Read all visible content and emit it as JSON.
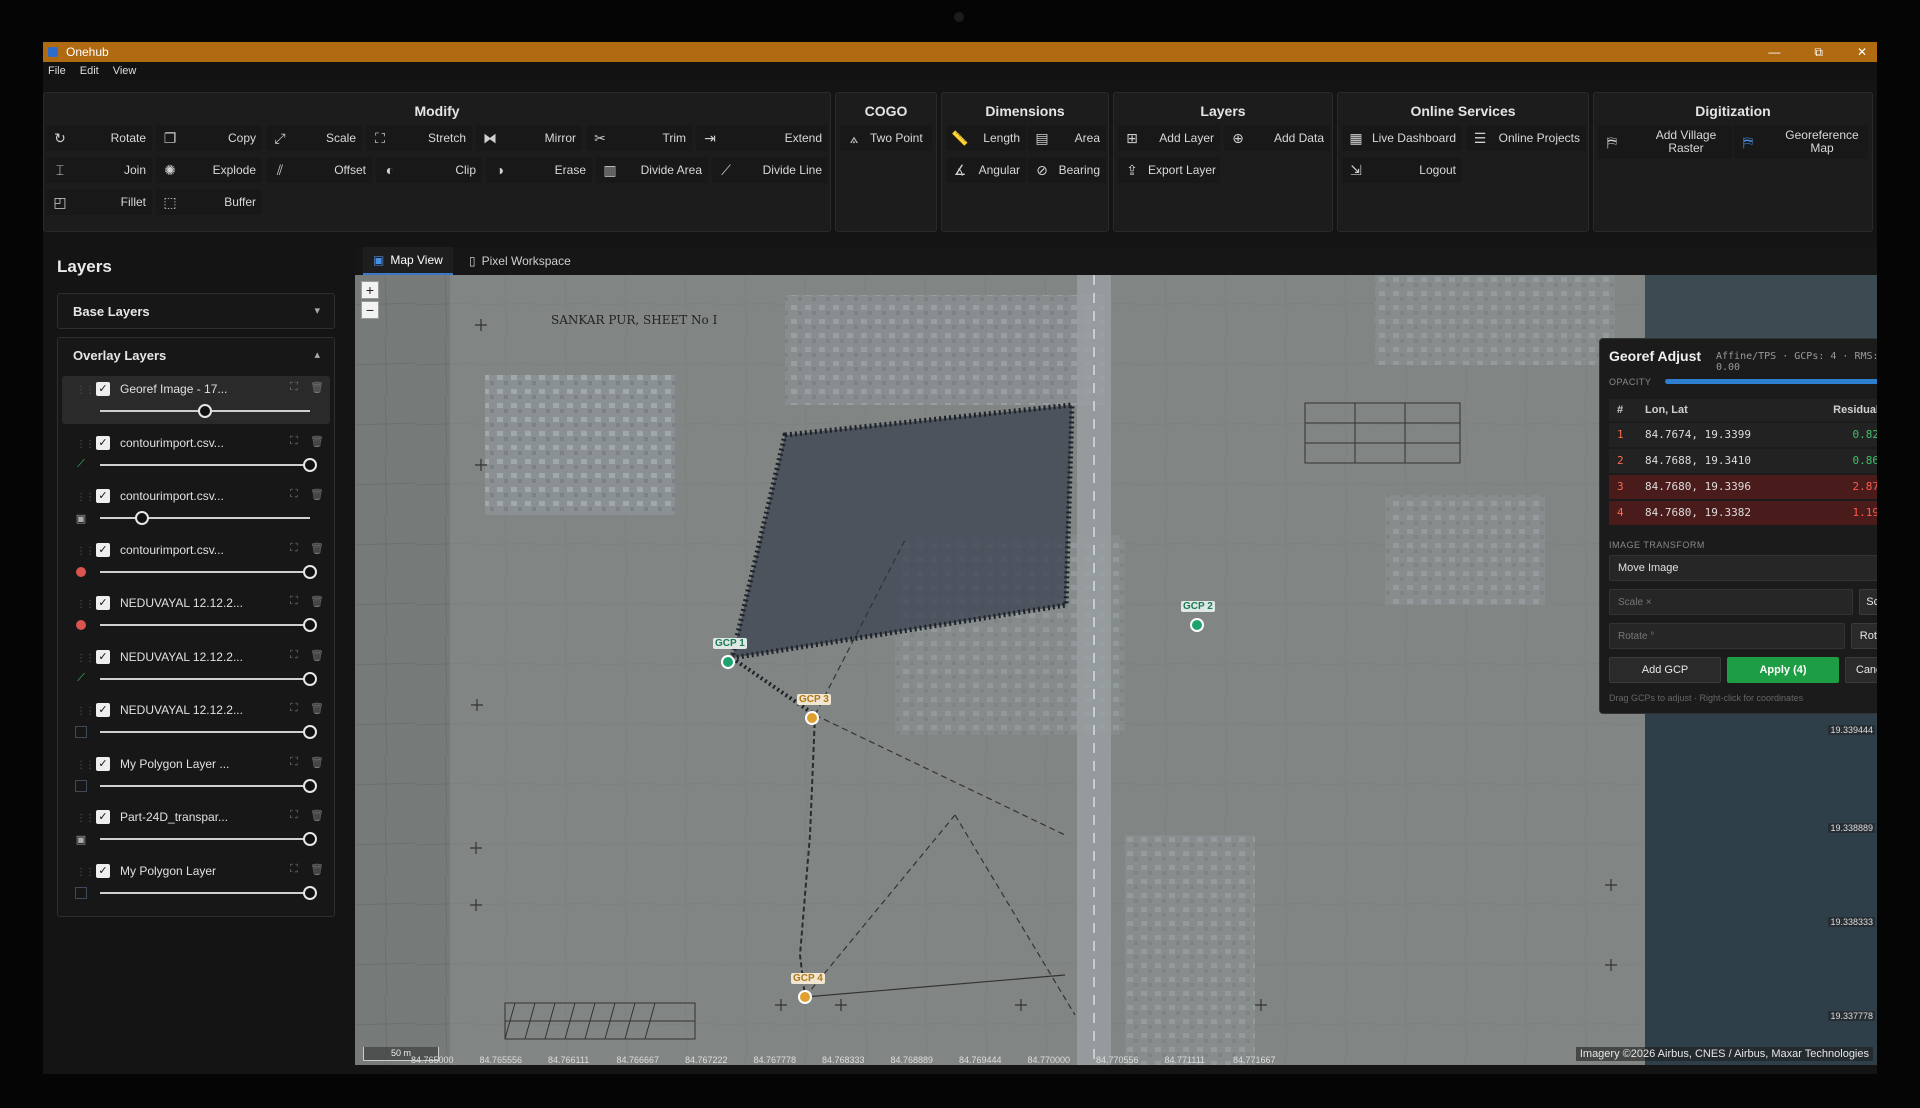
{
  "window": {
    "title": "Onehub",
    "controls": [
      "—",
      "⧉",
      "✕"
    ]
  },
  "menu": [
    "File",
    "Edit",
    "View"
  ],
  "ribbon": {
    "modify": {
      "title": "Modify",
      "tools": [
        "Rotate",
        "Copy",
        "Scale",
        "Stretch",
        "Mirror",
        "Trim",
        "Extend",
        "Join",
        "Explode",
        "Offset",
        "Clip",
        "Erase",
        "Divide Area",
        "Divide Line",
        "Fillet",
        "Buffer"
      ]
    },
    "cogo": {
      "title": "COGO",
      "tools": [
        "Two Point"
      ]
    },
    "dimensions": {
      "title": "Dimensions",
      "tools": [
        "Length",
        "Area",
        "Angular",
        "Bearing"
      ]
    },
    "layers": {
      "title": "Layers",
      "tools": [
        "Add Layer",
        "Add Data",
        "Export Layer"
      ]
    },
    "online": {
      "title": "Online Services",
      "tools": [
        "Live Dashboard",
        "Online Projects",
        "Logout"
      ]
    },
    "digitization": {
      "title": "Digitization",
      "tools": [
        "Add Village Raster",
        "Georeference Map"
      ]
    }
  },
  "sidebar": {
    "title": "Layers",
    "base_layers": "Base Layers",
    "overlay_layers": "Overlay Layers",
    "layers": [
      {
        "name": "Georef Image - 17...",
        "type": "none",
        "opacity": 0.5
      },
      {
        "name": "contourimport.csv...",
        "type": "line",
        "opacity": 1.0
      },
      {
        "name": "contourimport.csv...",
        "type": "image",
        "opacity": 0.2
      },
      {
        "name": "contourimport.csv...",
        "type": "point",
        "opacity": 1.0
      },
      {
        "name": "NEDUVAYAL 12.12.2...",
        "type": "point",
        "opacity": 1.0
      },
      {
        "name": "NEDUVAYAL 12.12.2...",
        "type": "line",
        "opacity": 1.0
      },
      {
        "name": "NEDUVAYAL 12.12.2...",
        "type": "polygon",
        "opacity": 1.0
      },
      {
        "name": "My Polygon Layer ...",
        "type": "polygon",
        "opacity": 1.0
      },
      {
        "name": "Part-24D_transpar...",
        "type": "image",
        "opacity": 1.0
      },
      {
        "name": "My Polygon Layer",
        "type": "polygon",
        "opacity": 1.0
      }
    ]
  },
  "tabs": [
    "Map View",
    "Pixel Workspace"
  ],
  "map": {
    "zoom_in": "+",
    "zoom_out": "−",
    "scale_label": "50 m",
    "attribution": "Imagery ©2026 Airbus, CNES / Airbus, Maxar Technologies",
    "x_ticks": [
      "84.765000",
      "84.765556",
      "84.766111",
      "84.766667",
      "84.767222",
      "84.767778",
      "84.768333",
      "84.768889",
      "84.769444",
      "84.770000",
      "84.770556",
      "84.771111",
      "84.771667"
    ],
    "y_ticks": [
      "19.339444",
      "19.338889",
      "19.338333",
      "19.337778"
    ],
    "gcp_labels": [
      "GCP 1",
      "GCP 2",
      "GCP 3",
      "GCP 4"
    ],
    "map_texts": [
      "SANKAR PUR, SHEET No I"
    ]
  },
  "georef": {
    "title": "Georef Adjust",
    "subtitle": "Affine/TPS · GCPs: 4 · RMS: 0.00",
    "opacity_label": "OPACITY",
    "opacity": 1.0,
    "columns": [
      "#",
      "Lon, Lat",
      "Residual"
    ],
    "rows": [
      {
        "n": "1",
        "ll": "84.7674, 19.3399",
        "res": "0.82",
        "status": "ok"
      },
      {
        "n": "2",
        "ll": "84.7688, 19.3410",
        "res": "0.86",
        "status": "ok"
      },
      {
        "n": "3",
        "ll": "84.7680, 19.3396",
        "res": "2.87",
        "status": "bad"
      },
      {
        "n": "4",
        "ll": "84.7680, 19.3382",
        "res": "1.19",
        "status": "bad"
      }
    ],
    "section": "IMAGE TRANSFORM",
    "move_image": "Move Image",
    "scale_placeholder": "Scale ×",
    "scale_btn": "Scale",
    "rotate_placeholder": "Rotate °",
    "rotate_btn": "Rotate",
    "add_gcp": "Add GCP",
    "apply": "Apply (4)",
    "cancel": "Cancel",
    "hint": "Drag GCPs to adjust · Right-click for coordinates"
  }
}
